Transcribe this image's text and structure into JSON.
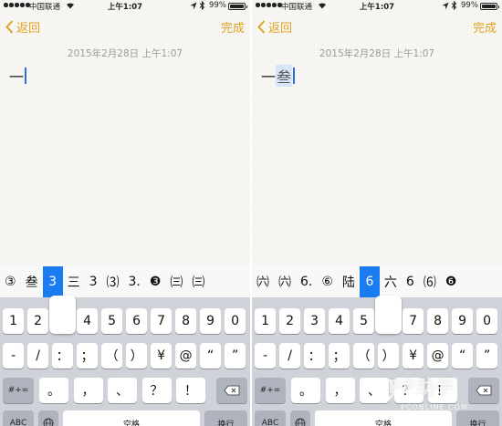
{
  "status": {
    "carrier": "中国联通",
    "time": "上午1:07",
    "battery_pct": "99%",
    "battery_level": 0.99
  },
  "nav": {
    "back_label": "返回",
    "done_label": "完成"
  },
  "note": {
    "date": "2015年2月28日 上午1:07"
  },
  "left": {
    "note_text": "一",
    "candidates": [
      "③",
      "叁",
      "3",
      "三",
      "3",
      "⑶",
      "3.",
      "❸",
      "㈢",
      "㈢"
    ],
    "selected_index": 2
  },
  "right": {
    "note_text": "一",
    "note_marked": "叁",
    "candidates": [
      "㈥",
      "㈥",
      "6.",
      "⑥",
      "陆",
      "6",
      "六",
      "6",
      "⑹",
      "❻"
    ],
    "selected_index": 5
  },
  "keyboard": {
    "row1": [
      "1",
      "2",
      "3",
      "4",
      "5",
      "6",
      "7",
      "8",
      "9",
      "0"
    ],
    "row2": [
      "-",
      "/",
      "：",
      "；",
      "（",
      "）",
      "¥",
      "@",
      "“",
      "”"
    ],
    "row3": [
      "#+=",
      "。",
      "，",
      "、",
      "？",
      "！",
      "."
    ],
    "row4": [
      "ABC",
      "空格",
      "换行"
    ]
  },
  "watermark": {
    "text": "PP助手",
    "sub": "PCONLINE.COM"
  }
}
